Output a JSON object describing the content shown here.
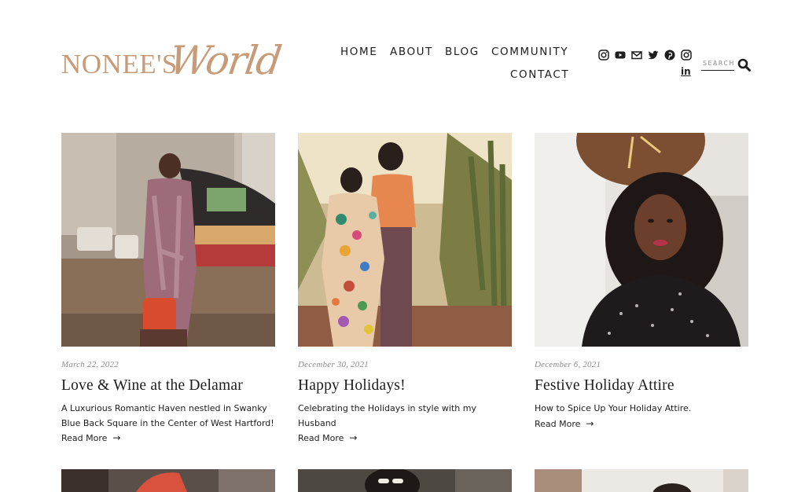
{
  "brand": {
    "logo_text": "NONEE'S",
    "logo_script": "World",
    "accent_color": "#c79b78"
  },
  "nav": {
    "items": [
      {
        "label": "HOME"
      },
      {
        "label": "ABOUT"
      },
      {
        "label": "BLOG"
      },
      {
        "label": "COMMUNITY"
      },
      {
        "label": "CONTACT"
      }
    ]
  },
  "social": {
    "icons": [
      "instagram-icon",
      "youtube-icon",
      "mail-icon",
      "twitter-icon",
      "pinterest-icon",
      "instagram-icon",
      "linkedin-icon"
    ],
    "linkedin_label": "in"
  },
  "search": {
    "placeholder": "SEARCH"
  },
  "posts": [
    {
      "date": "March 22, 2022",
      "title": "Love & Wine at the Delamar",
      "excerpt": "A Luxurious Romantic Haven nestled in Swanky Blue Back Square in the Center of West Hartford!",
      "read_more": "Read More"
    },
    {
      "date": "December 30, 2021",
      "title": "Happy Holidays!",
      "excerpt": "Celebrating the Holidays in style with my Husband",
      "read_more": "Read More"
    },
    {
      "date": "December 6, 2021",
      "title": "Festive Holiday Attire",
      "excerpt": "How to Spice Up Your Holiday Attire.",
      "read_more": "Read More"
    }
  ]
}
